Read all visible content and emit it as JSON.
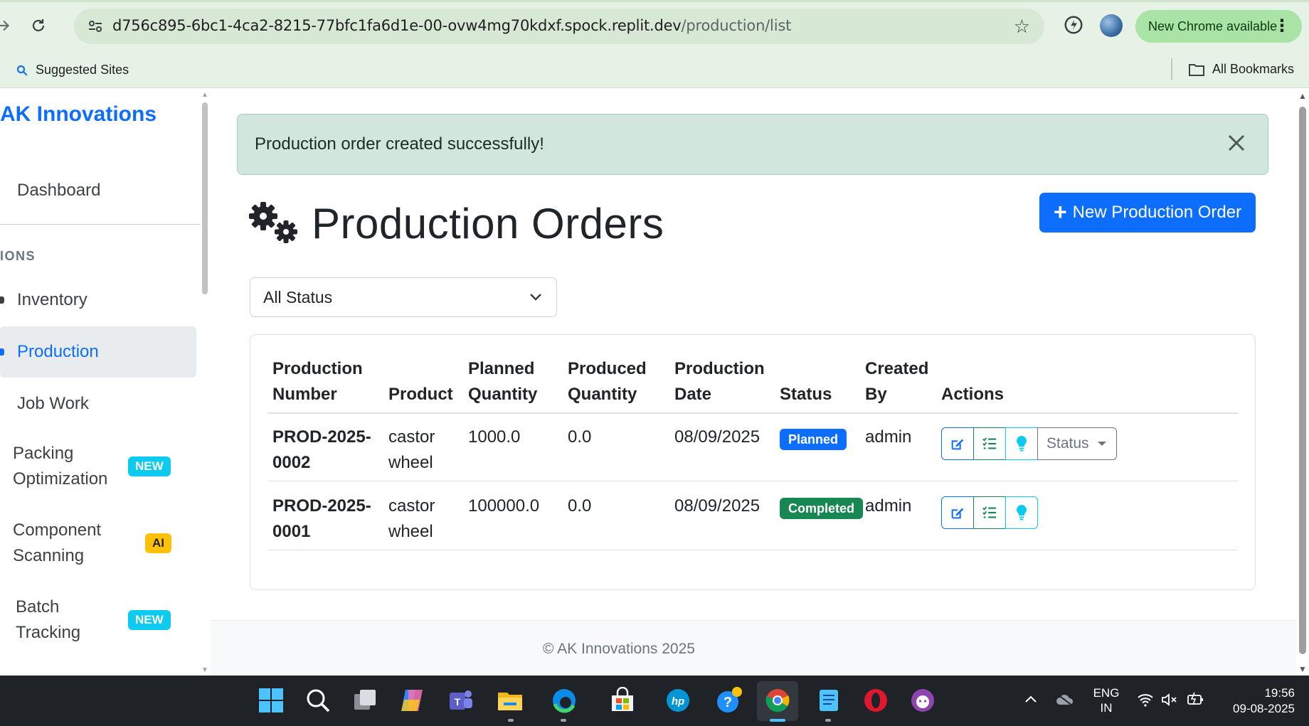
{
  "browser": {
    "url_host": "d756c895-6bc1-4ca2-8215-77bfc1fa6d1e-00-ovw4mg70kdxf.spock.replit.dev",
    "url_path": "/production/list",
    "new_chrome_label": "New Chrome available",
    "bookmark_suggested": "Suggested Sites",
    "bookmark_all": "All Bookmarks"
  },
  "sidebar": {
    "brand": "AK Innovations",
    "section_label": "IONS",
    "items": [
      {
        "label": "Dashboard"
      },
      {
        "label": "Inventory"
      },
      {
        "label": "Production"
      },
      {
        "label": "Job Work"
      },
      {
        "label": "Packing Optimization",
        "line1": "Packing",
        "line2": "Optimization",
        "badge": "NEW"
      },
      {
        "label": "Component Scanning",
        "line1": "Component",
        "line2": "Scanning",
        "badge": "AI"
      },
      {
        "label": "Batch Tracking",
        "line1": "Batch",
        "line2": "Tracking",
        "badge": "NEW"
      }
    ]
  },
  "alert": {
    "message": "Production order created successfully!"
  },
  "page": {
    "title": "Production Orders",
    "new_button": "New Production Order",
    "filter_value": "All Status",
    "footer": "© AK Innovations 2025"
  },
  "table": {
    "columns": [
      {
        "line1": "Production",
        "line2": "Number"
      },
      {
        "line1": "",
        "line2": "Product"
      },
      {
        "line1": "Planned",
        "line2": "Quantity"
      },
      {
        "line1": "Produced",
        "line2": "Quantity"
      },
      {
        "line1": "Production",
        "line2": "Date"
      },
      {
        "line1": "",
        "line2": "Status"
      },
      {
        "line1": "Created",
        "line2": "By"
      },
      {
        "line1": "",
        "line2": "Actions"
      }
    ],
    "rows": [
      {
        "number_l1": "PROD-2025-",
        "number_l2": "0002",
        "product_l1": "castor",
        "product_l2": "wheel",
        "planned": "1000.0",
        "produced": "0.0",
        "date": "08/09/2025",
        "status": "Planned",
        "created_by": "admin",
        "status_menu": "Status"
      },
      {
        "number_l1": "PROD-2025-",
        "number_l2": "0001",
        "product_l1": "castor",
        "product_l2": "wheel",
        "planned": "100000.0",
        "produced": "0.0",
        "date": "08/09/2025",
        "status": "Completed",
        "created_by": "admin"
      }
    ]
  },
  "taskbar": {
    "lang_1": "ENG",
    "lang_2": "IN",
    "time": "19:56",
    "date": "09-08-2025"
  },
  "colors": {
    "primary": "#0d6efd",
    "success": "#198754",
    "info": "#0dcaf0",
    "warning": "#ffc107",
    "alert_bg": "#d1e7dd"
  }
}
